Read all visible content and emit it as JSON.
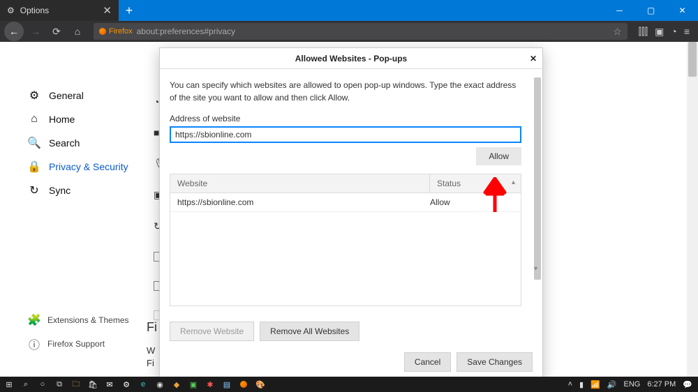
{
  "titlebar": {
    "tab_title": "Options",
    "close_glyph": "✕",
    "plus_glyph": "+"
  },
  "nav": {
    "firefox_label": "Firefox",
    "url": "about:preferences#privacy"
  },
  "sidebar": {
    "items": [
      {
        "label": "General"
      },
      {
        "label": "Home"
      },
      {
        "label": "Search"
      },
      {
        "label": "Privacy & Security"
      },
      {
        "label": "Sync"
      }
    ],
    "ext_label": "Extensions & Themes",
    "support_label": "Firefox Support"
  },
  "peek": {
    "f": "Fi",
    "w": "W",
    "fi": "Fi"
  },
  "modal": {
    "title": "Allowed Websites - Pop-ups",
    "close": "✕",
    "desc": "You can specify which websites are allowed to open pop-up windows. Type the exact address of the site you want to allow and then click Allow.",
    "addr_label": "Address of website",
    "addr_value": "https://sbionline.com",
    "allow_btn": "Allow",
    "col_website": "Website",
    "col_status": "Status",
    "rows": [
      {
        "site": "https://sbionline.com",
        "status": "Allow"
      }
    ],
    "remove_one": "Remove Website",
    "remove_all": "Remove All Websites",
    "cancel": "Cancel",
    "save": "Save Changes"
  },
  "systray": {
    "lang": "ENG",
    "time": "6:27 PM"
  }
}
